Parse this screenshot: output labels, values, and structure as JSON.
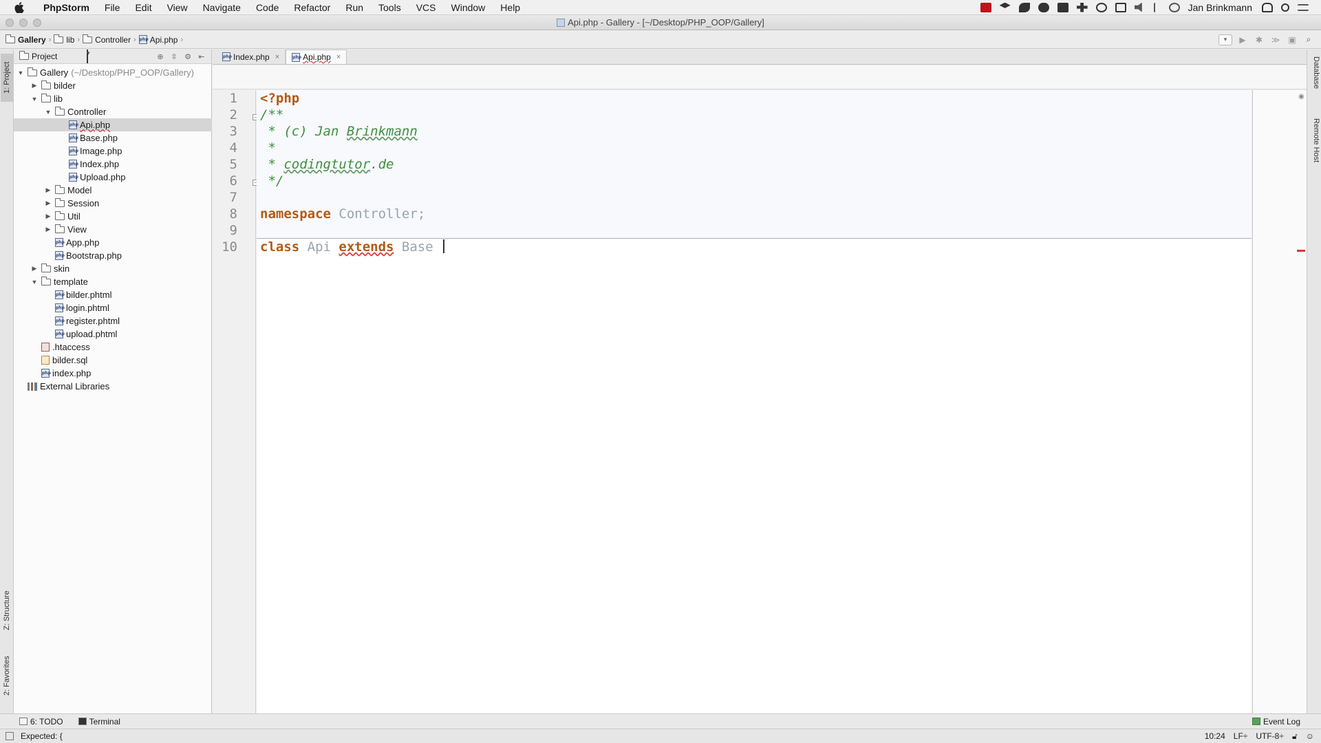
{
  "menubar": {
    "app_name": "PhpStorm",
    "items": [
      "File",
      "Edit",
      "View",
      "Navigate",
      "Code",
      "Refactor",
      "Run",
      "Tools",
      "VCS",
      "Window",
      "Help"
    ],
    "user": "Jan Brinkmann"
  },
  "window": {
    "title": "Api.php - Gallery - [~/Desktop/PHP_OOP/Gallery]"
  },
  "navbar": {
    "crumbs": [
      "Gallery",
      "lib",
      "Controller",
      "Api.php"
    ]
  },
  "left_stripe": {
    "project_tab": "1: Project",
    "structure_tab": "Z: Structure",
    "favorites_tab": "2: Favorites"
  },
  "project": {
    "view_selector": "Project",
    "tree": [
      {
        "label": "Gallery",
        "hint": "(~/Desktop/PHP_OOP/Gallery)",
        "type": "folder",
        "expanded": true
      },
      {
        "label": "bilder",
        "type": "folder",
        "expanded": false
      },
      {
        "label": "lib",
        "type": "folder",
        "expanded": true
      },
      {
        "label": "Controller",
        "type": "folder",
        "expanded": true
      },
      {
        "label": "Api.php",
        "type": "php",
        "selected": true
      },
      {
        "label": "Base.php",
        "type": "php"
      },
      {
        "label": "Image.php",
        "type": "php"
      },
      {
        "label": "Index.php",
        "type": "php"
      },
      {
        "label": "Upload.php",
        "type": "php"
      },
      {
        "label": "Model",
        "type": "folder",
        "expanded": false
      },
      {
        "label": "Session",
        "type": "folder",
        "expanded": false
      },
      {
        "label": "Util",
        "type": "folder",
        "expanded": false
      },
      {
        "label": "View",
        "type": "folder",
        "expanded": false
      },
      {
        "label": "App.php",
        "type": "php"
      },
      {
        "label": "Bootstrap.php",
        "type": "php"
      },
      {
        "label": "skin",
        "type": "folder",
        "expanded": false
      },
      {
        "label": "template",
        "type": "folder",
        "expanded": true
      },
      {
        "label": "bilder.phtml",
        "type": "php"
      },
      {
        "label": "login.phtml",
        "type": "php"
      },
      {
        "label": "register.phtml",
        "type": "php"
      },
      {
        "label": "upload.phtml",
        "type": "php"
      },
      {
        "label": ".htaccess",
        "type": "htaccess"
      },
      {
        "label": "bilder.sql",
        "type": "sql"
      },
      {
        "label": "index.php",
        "type": "php"
      },
      {
        "label": "External Libraries",
        "type": "library"
      }
    ]
  },
  "tabs": [
    {
      "label": "Index.php",
      "active": false
    },
    {
      "label": "Api.php",
      "active": true
    }
  ],
  "editor": {
    "line_numbers": [
      "1",
      "2",
      "3",
      "4",
      "5",
      "6",
      "7",
      "8",
      "9",
      "10"
    ],
    "lines": {
      "l1": "<?php",
      "l2": "/**",
      "l3_prefix": " * (c) Jan ",
      "l3_name": "Brinkmann",
      "l4": " *",
      "l5_prefix": " * ",
      "l5_site": "codingtutor",
      "l5_suffix": ".de",
      "l6": " */",
      "l8_kw": "namespace",
      "l8_rest": " Controller;",
      "l10_kw1": "class",
      "l10_name": " Api ",
      "l10_kw2": "extends",
      "l10_base": " Base "
    }
  },
  "right_stripe": {
    "database_tab": "Database",
    "remote_tab": "Remote Host"
  },
  "bottom_tools": {
    "todo": "6: TODO",
    "terminal": "Terminal",
    "event_log": "Event Log"
  },
  "status": {
    "message": "Expected: {",
    "position": "10:24",
    "line_sep": "LF÷",
    "encoding": "UTF-8÷"
  }
}
